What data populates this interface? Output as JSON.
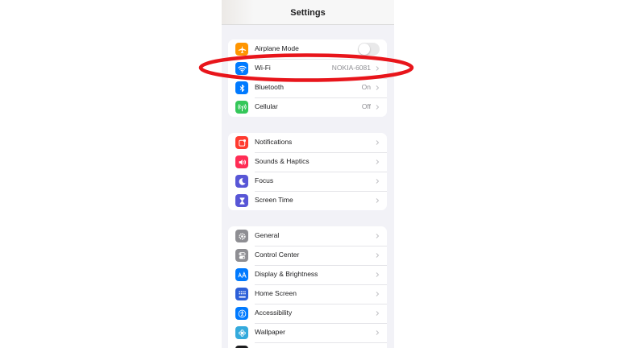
{
  "nav": {
    "title": "Settings"
  },
  "groups": [
    {
      "rows": [
        {
          "label": "Airplane Mode",
          "icon": "airplane-icon",
          "icon_color": "#ff9500",
          "toggle": false
        },
        {
          "label": "Wi-Fi",
          "value": "NOKIA-6081",
          "icon": "wifi-icon",
          "icon_color": "#007aff"
        },
        {
          "label": "Bluetooth",
          "value": "On",
          "icon": "bluetooth-icon",
          "icon_color": "#007aff"
        },
        {
          "label": "Cellular",
          "value": "Off",
          "icon": "cellular-icon",
          "icon_color": "#34c759"
        }
      ]
    },
    {
      "rows": [
        {
          "label": "Notifications",
          "icon": "notifications-icon",
          "icon_color": "#ff3b30"
        },
        {
          "label": "Sounds & Haptics",
          "icon": "speaker-icon",
          "icon_color": "#ff2d55"
        },
        {
          "label": "Focus",
          "icon": "moon-icon",
          "icon_color": "#5856d6"
        },
        {
          "label": "Screen Time",
          "icon": "hourglass-icon",
          "icon_color": "#5856d6"
        }
      ]
    },
    {
      "rows": [
        {
          "label": "General",
          "icon": "gear-icon",
          "icon_color": "#8e8e93"
        },
        {
          "label": "Control Center",
          "icon": "switches-icon",
          "icon_color": "#8e8e93"
        },
        {
          "label": "Display & Brightness",
          "icon": "text-size-icon",
          "icon_color": "#007aff"
        },
        {
          "label": "Home Screen",
          "icon": "app-grid-icon",
          "icon_color": "#2c5fd8"
        },
        {
          "label": "Accessibility",
          "icon": "accessibility-icon",
          "icon_color": "#007aff"
        },
        {
          "label": "Wallpaper",
          "icon": "flower-icon",
          "icon_color": "#34aadc"
        }
      ]
    }
  ],
  "annotation": {
    "shape": "ellipse",
    "color": "#e8151b",
    "target": "Wi-Fi"
  }
}
